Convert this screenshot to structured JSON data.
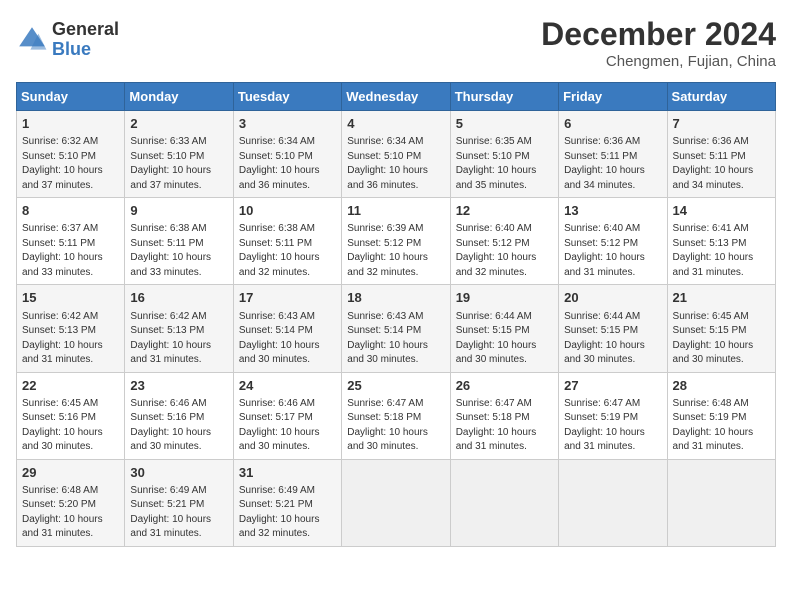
{
  "header": {
    "logo_general": "General",
    "logo_blue": "Blue",
    "month_title": "December 2024",
    "location": "Chengmen, Fujian, China"
  },
  "weekdays": [
    "Sunday",
    "Monday",
    "Tuesday",
    "Wednesday",
    "Thursday",
    "Friday",
    "Saturday"
  ],
  "weeks": [
    [
      {
        "day": "1",
        "info": "Sunrise: 6:32 AM\nSunset: 5:10 PM\nDaylight: 10 hours\nand 37 minutes."
      },
      {
        "day": "2",
        "info": "Sunrise: 6:33 AM\nSunset: 5:10 PM\nDaylight: 10 hours\nand 37 minutes."
      },
      {
        "day": "3",
        "info": "Sunrise: 6:34 AM\nSunset: 5:10 PM\nDaylight: 10 hours\nand 36 minutes."
      },
      {
        "day": "4",
        "info": "Sunrise: 6:34 AM\nSunset: 5:10 PM\nDaylight: 10 hours\nand 36 minutes."
      },
      {
        "day": "5",
        "info": "Sunrise: 6:35 AM\nSunset: 5:10 PM\nDaylight: 10 hours\nand 35 minutes."
      },
      {
        "day": "6",
        "info": "Sunrise: 6:36 AM\nSunset: 5:11 PM\nDaylight: 10 hours\nand 34 minutes."
      },
      {
        "day": "7",
        "info": "Sunrise: 6:36 AM\nSunset: 5:11 PM\nDaylight: 10 hours\nand 34 minutes."
      }
    ],
    [
      {
        "day": "8",
        "info": "Sunrise: 6:37 AM\nSunset: 5:11 PM\nDaylight: 10 hours\nand 33 minutes."
      },
      {
        "day": "9",
        "info": "Sunrise: 6:38 AM\nSunset: 5:11 PM\nDaylight: 10 hours\nand 33 minutes."
      },
      {
        "day": "10",
        "info": "Sunrise: 6:38 AM\nSunset: 5:11 PM\nDaylight: 10 hours\nand 32 minutes."
      },
      {
        "day": "11",
        "info": "Sunrise: 6:39 AM\nSunset: 5:12 PM\nDaylight: 10 hours\nand 32 minutes."
      },
      {
        "day": "12",
        "info": "Sunrise: 6:40 AM\nSunset: 5:12 PM\nDaylight: 10 hours\nand 32 minutes."
      },
      {
        "day": "13",
        "info": "Sunrise: 6:40 AM\nSunset: 5:12 PM\nDaylight: 10 hours\nand 31 minutes."
      },
      {
        "day": "14",
        "info": "Sunrise: 6:41 AM\nSunset: 5:13 PM\nDaylight: 10 hours\nand 31 minutes."
      }
    ],
    [
      {
        "day": "15",
        "info": "Sunrise: 6:42 AM\nSunset: 5:13 PM\nDaylight: 10 hours\nand 31 minutes."
      },
      {
        "day": "16",
        "info": "Sunrise: 6:42 AM\nSunset: 5:13 PM\nDaylight: 10 hours\nand 31 minutes."
      },
      {
        "day": "17",
        "info": "Sunrise: 6:43 AM\nSunset: 5:14 PM\nDaylight: 10 hours\nand 30 minutes."
      },
      {
        "day": "18",
        "info": "Sunrise: 6:43 AM\nSunset: 5:14 PM\nDaylight: 10 hours\nand 30 minutes."
      },
      {
        "day": "19",
        "info": "Sunrise: 6:44 AM\nSunset: 5:15 PM\nDaylight: 10 hours\nand 30 minutes."
      },
      {
        "day": "20",
        "info": "Sunrise: 6:44 AM\nSunset: 5:15 PM\nDaylight: 10 hours\nand 30 minutes."
      },
      {
        "day": "21",
        "info": "Sunrise: 6:45 AM\nSunset: 5:15 PM\nDaylight: 10 hours\nand 30 minutes."
      }
    ],
    [
      {
        "day": "22",
        "info": "Sunrise: 6:45 AM\nSunset: 5:16 PM\nDaylight: 10 hours\nand 30 minutes."
      },
      {
        "day": "23",
        "info": "Sunrise: 6:46 AM\nSunset: 5:16 PM\nDaylight: 10 hours\nand 30 minutes."
      },
      {
        "day": "24",
        "info": "Sunrise: 6:46 AM\nSunset: 5:17 PM\nDaylight: 10 hours\nand 30 minutes."
      },
      {
        "day": "25",
        "info": "Sunrise: 6:47 AM\nSunset: 5:18 PM\nDaylight: 10 hours\nand 30 minutes."
      },
      {
        "day": "26",
        "info": "Sunrise: 6:47 AM\nSunset: 5:18 PM\nDaylight: 10 hours\nand 31 minutes."
      },
      {
        "day": "27",
        "info": "Sunrise: 6:47 AM\nSunset: 5:19 PM\nDaylight: 10 hours\nand 31 minutes."
      },
      {
        "day": "28",
        "info": "Sunrise: 6:48 AM\nSunset: 5:19 PM\nDaylight: 10 hours\nand 31 minutes."
      }
    ],
    [
      {
        "day": "29",
        "info": "Sunrise: 6:48 AM\nSunset: 5:20 PM\nDaylight: 10 hours\nand 31 minutes."
      },
      {
        "day": "30",
        "info": "Sunrise: 6:49 AM\nSunset: 5:21 PM\nDaylight: 10 hours\nand 31 minutes."
      },
      {
        "day": "31",
        "info": "Sunrise: 6:49 AM\nSunset: 5:21 PM\nDaylight: 10 hours\nand 32 minutes."
      },
      null,
      null,
      null,
      null
    ]
  ]
}
